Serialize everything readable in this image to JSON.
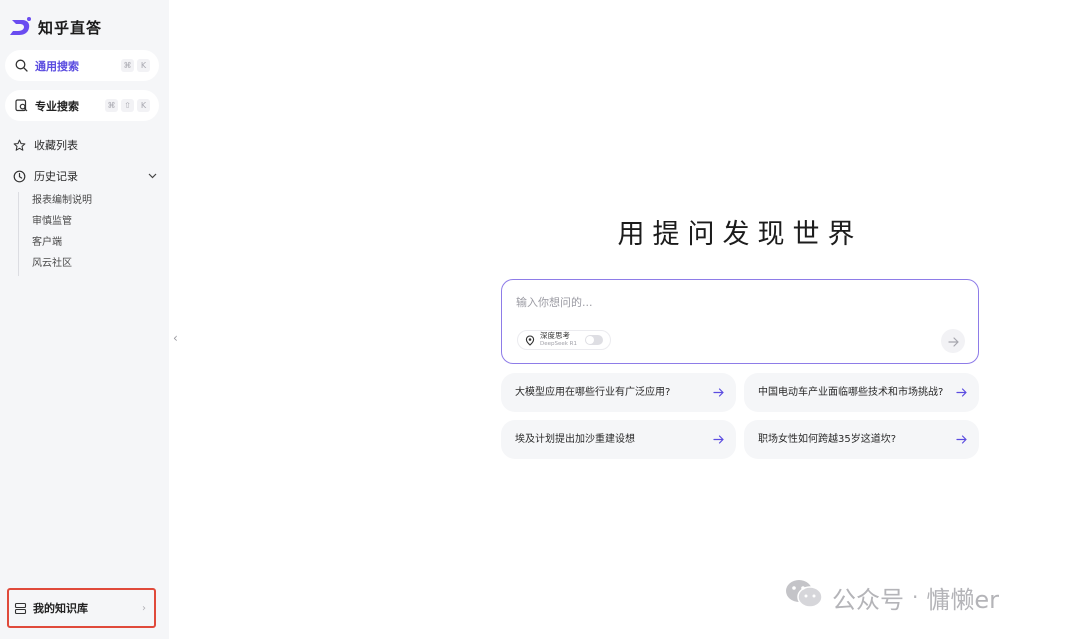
{
  "app": {
    "name": "知乎直答",
    "accent": "#5b4ce0"
  },
  "sidebar": {
    "general_search": {
      "label": "通用搜索",
      "shortcut": [
        "⌘",
        "K"
      ],
      "icon": "search-icon"
    },
    "pro_search": {
      "label": "专业搜索",
      "shortcut": [
        "⌘",
        "⇧",
        "K"
      ],
      "icon": "pro-search-icon"
    },
    "favorites": {
      "label": "收藏列表",
      "icon": "star-icon"
    },
    "history": {
      "label": "历史记录",
      "icon": "clock-icon",
      "items": [
        "报表编制说明",
        "审慎监管",
        "客户端",
        "风云社区"
      ]
    },
    "knowledge_base": {
      "label": "我的知识库",
      "arrow": "›",
      "icon": "knowledge-base-icon"
    },
    "collapse": "‹"
  },
  "main": {
    "title": "用提问发现世界",
    "input": {
      "placeholder": "输入你想问的...",
      "deep_think_label": "深度思考",
      "deep_think_sub": "DeepSeek R1",
      "deep_think_enabled": false
    },
    "suggestions": [
      "大模型应用在哪些行业有广泛应用?",
      "中国电动车产业面临哪些技术和市场挑战?",
      "埃及计划提出加沙重建设想",
      "职场女性如何跨越35岁这道坎?"
    ]
  },
  "watermark": {
    "text1": "公众号",
    "dot": "·",
    "text2": "慵懒er"
  }
}
